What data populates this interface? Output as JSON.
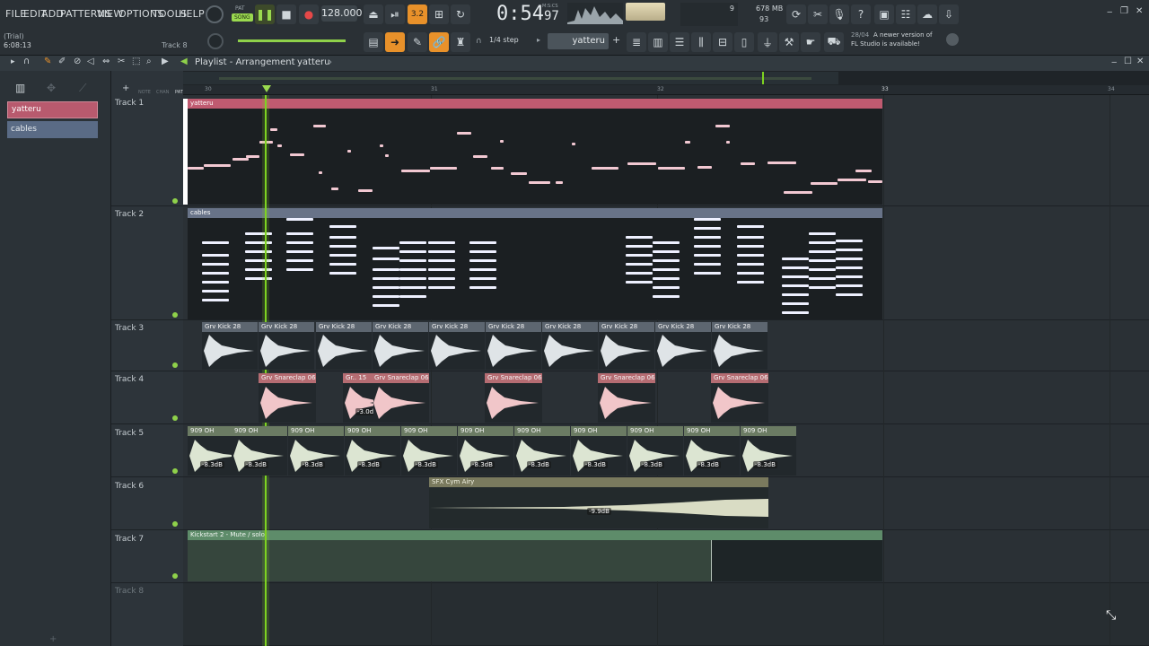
{
  "menu": [
    "FILE",
    "EDIT",
    "ADD",
    "PATTERNS",
    "VIEW",
    "OPTIONS",
    "TOOLS",
    "HELP"
  ],
  "transport": {
    "mode_pat": "PAT",
    "mode_song": "SONG",
    "tempo": "128.000",
    "time_main": "0:54",
    "time_sub": "97",
    "time_unit": "M:S:CS",
    "step_label": "1/4 step",
    "pattern_name": "yatteru",
    "snap_value": "3.2",
    "cpu_value": "9",
    "memory": "678 MB",
    "voices": "93"
  },
  "info": {
    "trial": "(Trial)",
    "clock": "6:08:13",
    "hint_track": "Track 8",
    "news_date": "28/04",
    "news_text_1": "A newer version of",
    "news_text_2": "FL Studio is available!"
  },
  "playlist": {
    "title": "Playlist - Arrangement",
    "breadcrumb": "yatteru",
    "left_header": [
      "NOTE",
      "CHAN",
      "PAT"
    ],
    "patterns": [
      {
        "name": "yatteru",
        "color": "#b85a6e"
      },
      {
        "name": "cables",
        "color": "#5a6b85"
      }
    ],
    "ruler": [
      "30",
      "31",
      "32",
      "33",
      "34"
    ]
  },
  "tracks": [
    {
      "name": "Track 1"
    },
    {
      "name": "Track 2"
    },
    {
      "name": "Track 3"
    },
    {
      "name": "Track 4"
    },
    {
      "name": "Track 5"
    },
    {
      "name": "Track 6"
    },
    {
      "name": "Track 7"
    },
    {
      "name": "Track 8"
    }
  ],
  "clips": {
    "yatteru": "yatteru",
    "cables": "cables",
    "kick": "Grv Kick 28",
    "snare": "Grv Snareclap 06",
    "snare_short": "Gr.. 15",
    "hat": "909 OH",
    "cym": "SFX Cym Airy",
    "auto": "Kickstart 2 - Mute / solo",
    "hat_db": "-8.3dB",
    "snare_db": "-3.0dB",
    "cym_db": "-9.9dB"
  },
  "colors": {
    "pattern_pink": "#c05a70",
    "pattern_slate": "#687388",
    "audio_gray": "#5d6670",
    "audio_red": "#b56c72",
    "audio_green": "#6b7b63",
    "audio_olive": "#7a7a5e",
    "auto_green": "#5e8c6a",
    "playhead": "#7ed321"
  }
}
